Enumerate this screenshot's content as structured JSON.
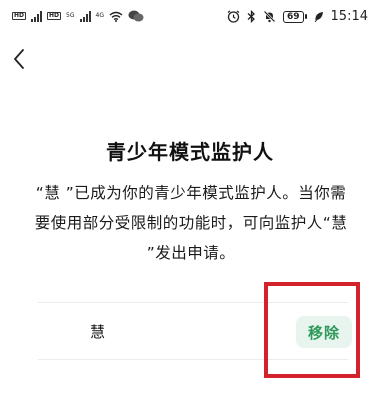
{
  "status_bar": {
    "left_badges": [
      "HD",
      "HD"
    ],
    "left_small": [
      "5G",
      "4G"
    ],
    "battery": "69",
    "time": "15:14",
    "icons": [
      "signal-icon",
      "wifi-icon",
      "wechat-icon",
      "alarm-icon",
      "bluetooth-icon",
      "mute-icon",
      "battery-icon",
      "leaf-icon"
    ]
  },
  "header": {
    "back_icon": "chevron-left-icon"
  },
  "content": {
    "title": "青少年模式监护人",
    "description": "“慧   ”已成为你的青少年模式监护人。当你需要使用部分受限制的功能时，可向监护人“慧   ”发出申请。"
  },
  "guardian": {
    "name": "慧",
    "remove_label": "移除"
  },
  "colors": {
    "accent_green": "#2f9a5a",
    "remove_bg": "#e8f5ee",
    "highlight_red": "#d3222c"
  }
}
